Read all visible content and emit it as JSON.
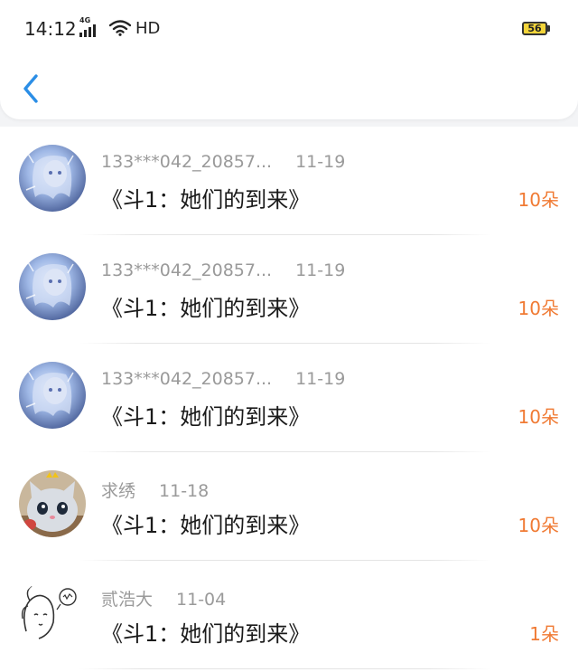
{
  "status_bar": {
    "time": "14:12",
    "network": "4G",
    "hd_label": "HD",
    "battery_level": "56"
  },
  "nav": {
    "back_icon": "chevron-left-icon"
  },
  "colors": {
    "accent_blue": "#2b8ee6",
    "gift_orange": "#f07a33",
    "meta_gray": "#9a9a9a"
  },
  "items": [
    {
      "user": "133***042_20857...",
      "date": "11-19",
      "title": "《斗1：她们的到来》",
      "gift": "10朵",
      "avatar": "anime-avatar"
    },
    {
      "user": "133***042_20857...",
      "date": "11-19",
      "title": "《斗1：她们的到来》",
      "gift": "10朵",
      "avatar": "anime-avatar"
    },
    {
      "user": "133***042_20857...",
      "date": "11-19",
      "title": "《斗1：她们的到来》",
      "gift": "10朵",
      "avatar": "anime-avatar"
    },
    {
      "user": "求绣",
      "date": "11-18",
      "title": "《斗1：她们的到来》",
      "gift": "10朵",
      "avatar": "plush-cat-avatar"
    },
    {
      "user": "贰浩大",
      "date": "11-04",
      "title": "《斗1：她们的到来》",
      "gift": "1朵",
      "avatar": "doodle-girl-avatar"
    }
  ]
}
